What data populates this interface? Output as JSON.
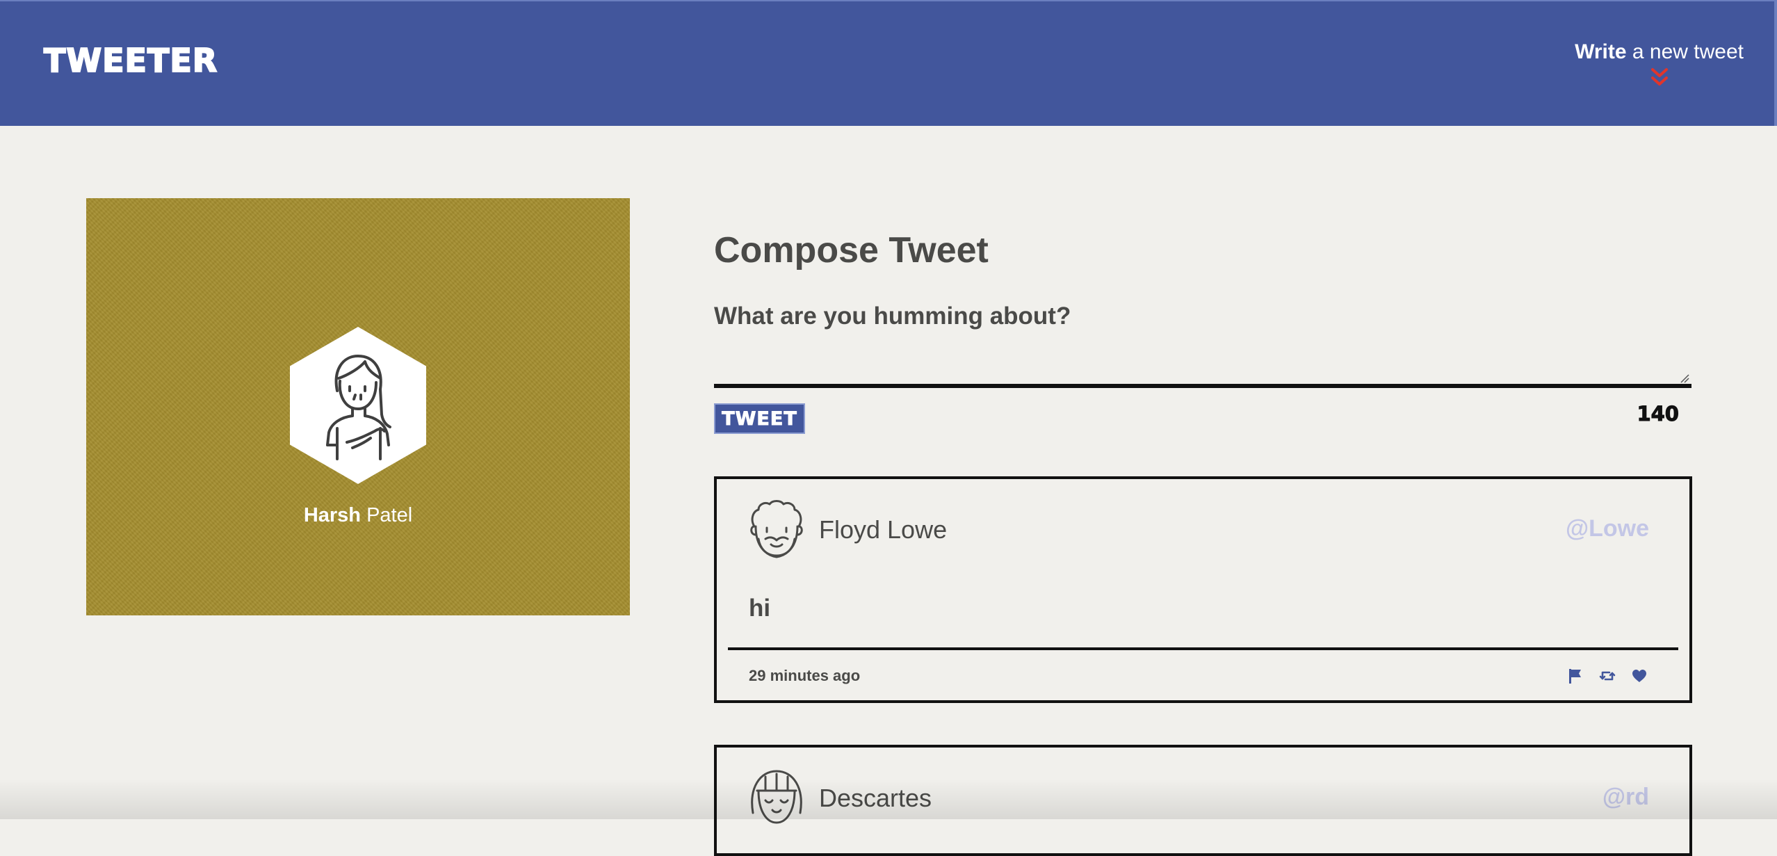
{
  "nav": {
    "brand": "TWEETER",
    "compose_toggle_strong": "Write",
    "compose_toggle_rest": " a new tweet",
    "chevron_icon": "double-chevron-down-icon",
    "chevron_color": "#e0352b"
  },
  "colors": {
    "nav_background": "#42569c",
    "page_background": "#f1f0ec",
    "profile_background": "#a48d2e",
    "handle_color": "#c3c6e6",
    "action_icon_color": "#42569c"
  },
  "profile": {
    "first_name": "Harsh",
    "last_name": " Patel",
    "avatar_icon": "girl-avatar-icon"
  },
  "compose": {
    "title": "Compose Tweet",
    "prompt": "What are you humming about?",
    "input_value": "",
    "button_label": "TWEET",
    "counter": "140"
  },
  "tweets": [
    {
      "author": "Floyd Lowe",
      "handle": "@Lowe",
      "content": "hi",
      "timestamp": "29 minutes ago",
      "avatar_icon": "bearded-man-avatar-icon",
      "actions": [
        "flag-icon",
        "retweet-icon",
        "heart-icon"
      ]
    },
    {
      "author": "Descartes",
      "handle": "@rd",
      "avatar_icon": "girl-bangs-avatar-icon"
    }
  ]
}
